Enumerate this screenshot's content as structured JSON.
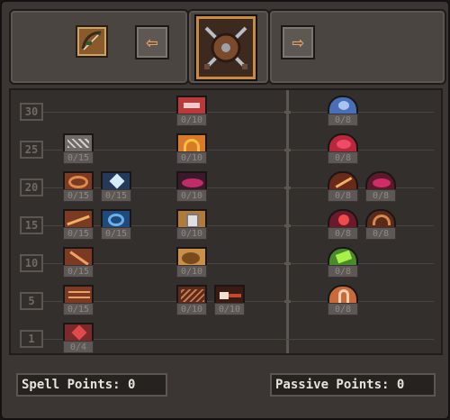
{
  "header": {
    "prev_label": "⇦",
    "next_label": "⇨",
    "selected_tab_icon": "bow-arrow-icon",
    "current_class_icon": "shield-swords-icon"
  },
  "rows": [
    "30",
    "25",
    "20",
    "15",
    "10",
    "5",
    "1"
  ],
  "spells": [
    {
      "name": "skill-spell-30-a",
      "count": "0/10",
      "icon": "pink-eye-icon",
      "color": "#b83a3a"
    },
    {
      "name": "skill-spell-25-a",
      "count": "0/15",
      "icon": "chain-icon",
      "color": "#9a9391"
    },
    {
      "name": "skill-spell-25-b",
      "count": "0/10",
      "icon": "fire-arc-icon",
      "color": "#d87a2a"
    },
    {
      "name": "skill-spell-20-a",
      "count": "0/15",
      "icon": "whirl-icon",
      "color": "#b0542a"
    },
    {
      "name": "skill-spell-20-b",
      "count": "0/15",
      "icon": "ice-burst-icon",
      "color": "#3c6fa3"
    },
    {
      "name": "skill-spell-20-c",
      "count": "0/10",
      "icon": "magenta-burst-icon",
      "color": "#9c2b5a"
    },
    {
      "name": "skill-spell-15-a",
      "count": "0/15",
      "icon": "arrow-fire-icon",
      "color": "#b35a2b"
    },
    {
      "name": "skill-spell-15-b",
      "count": "0/15",
      "icon": "blue-swirl-icon",
      "color": "#3876b8"
    },
    {
      "name": "skill-spell-15-c",
      "count": "0/10",
      "icon": "gate-icon",
      "color": "#c88a4a"
    },
    {
      "name": "skill-spell-10-a",
      "count": "0/15",
      "icon": "slash-icon",
      "color": "#a7542a"
    },
    {
      "name": "skill-spell-10-b",
      "count": "0/10",
      "icon": "boulder-icon",
      "color": "#b07d3a"
    },
    {
      "name": "skill-spell-5-a",
      "count": "0/15",
      "icon": "arrows-icon",
      "color": "#a1542c"
    },
    {
      "name": "skill-spell-5-b",
      "count": "0/10",
      "icon": "web-icon",
      "color": "#8c4a2e"
    },
    {
      "name": "skill-spell-5-c",
      "count": "0/10",
      "icon": "beam-icon",
      "color": "#7a3a24"
    },
    {
      "name": "skill-spell-1-a",
      "count": "0/4",
      "icon": "red-arrow-icon",
      "color": "#a63a3a"
    }
  ],
  "passives": [
    {
      "name": "skill-passive-30",
      "count": "0/8",
      "icon": "blue-orb-icon",
      "color": "#4a6fb8"
    },
    {
      "name": "skill-passive-25",
      "count": "0/8",
      "icon": "red-orb-icon",
      "color": "#b8283a"
    },
    {
      "name": "skill-passive-20-a",
      "count": "0/8",
      "icon": "arrow-orb-icon",
      "color": "#b85a2a"
    },
    {
      "name": "skill-passive-20-b",
      "count": "0/8",
      "icon": "magenta-orb-icon",
      "color": "#a82a5a"
    },
    {
      "name": "skill-passive-15-a",
      "count": "0/8",
      "icon": "ruby-orb-icon",
      "color": "#b8283a"
    },
    {
      "name": "skill-passive-15-b",
      "count": "0/8",
      "icon": "bronze-orb-icon",
      "color": "#b86a2a"
    },
    {
      "name": "skill-passive-10",
      "count": "0/8",
      "icon": "green-orb-icon",
      "color": "#6ab82a"
    },
    {
      "name": "skill-passive-5",
      "count": "0/8",
      "icon": "orange-arch-icon",
      "color": "#c86a3a"
    }
  ],
  "footer": {
    "spell_points": "Spell Points: 0",
    "passive_points": "Passive Points: 0"
  }
}
